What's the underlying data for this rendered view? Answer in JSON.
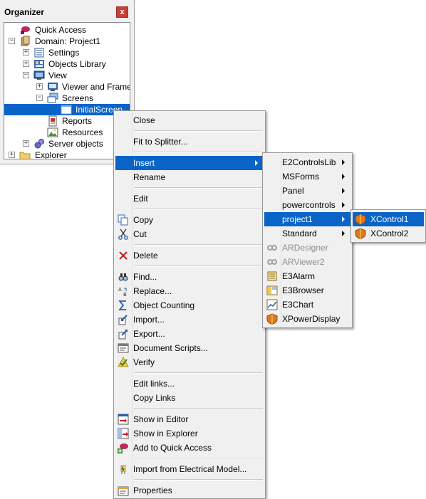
{
  "organizer": {
    "title": "Organizer",
    "close_label": "x",
    "tree": [
      {
        "label": "Quick Access",
        "icon": "quick-access-icon"
      },
      {
        "label": "Domain: Project1",
        "icon": "domain-icon",
        "expander": "−"
      },
      {
        "label": "Settings",
        "icon": "settings-icon",
        "expander": "+"
      },
      {
        "label": "Objects Library",
        "icon": "objects-library-icon",
        "expander": "+"
      },
      {
        "label": "View",
        "icon": "view-icon",
        "expander": "−"
      },
      {
        "label": "Viewer and Frames",
        "icon": "viewer-frames-icon",
        "expander": "+"
      },
      {
        "label": "Screens",
        "icon": "screens-icon",
        "expander": "−"
      },
      {
        "label": "InitialScreen",
        "icon": "screen-icon",
        "selected": true
      },
      {
        "label": "Reports",
        "icon": "reports-icon"
      },
      {
        "label": "Resources",
        "icon": "resources-icon"
      },
      {
        "label": "Server objects",
        "icon": "server-objects-icon",
        "expander": "+"
      },
      {
        "label": "Explorer",
        "icon": "explorer-folder-icon",
        "expander": "+"
      }
    ]
  },
  "context_menu": {
    "items": [
      {
        "label": "Close"
      },
      {
        "label": "Fit to Splitter..."
      },
      {
        "label": "Insert",
        "highlighted": true,
        "submenu": true
      },
      {
        "label": "Rename"
      },
      {
        "label": "Edit"
      },
      {
        "label": "Copy",
        "icon": "copy-icon"
      },
      {
        "label": "Cut",
        "icon": "cut-icon"
      },
      {
        "label": "Delete",
        "icon": "delete-icon"
      },
      {
        "label": "Find...",
        "icon": "find-icon"
      },
      {
        "label": "Replace...",
        "icon": "replace-icon"
      },
      {
        "label": "Object Counting",
        "icon": "sigma-icon"
      },
      {
        "label": "Import...",
        "icon": "import-icon"
      },
      {
        "label": "Export...",
        "icon": "export-icon"
      },
      {
        "label": "Document Scripts...",
        "icon": "scripts-icon"
      },
      {
        "label": "Verify",
        "icon": "verify-icon"
      },
      {
        "label": "Edit links..."
      },
      {
        "label": "Copy Links"
      },
      {
        "label": "Show in Editor",
        "icon": "show-editor-icon"
      },
      {
        "label": "Show in Explorer",
        "icon": "show-explorer-icon"
      },
      {
        "label": "Add to Quick Access",
        "icon": "add-quick-access-icon"
      },
      {
        "label": "Import from Electrical Model...",
        "icon": "electrical-model-icon"
      },
      {
        "label": "Properties",
        "icon": "properties-icon"
      }
    ]
  },
  "insert_submenu": {
    "items": [
      {
        "label": "E2ControlsLib",
        "submenu": true
      },
      {
        "label": "MSForms",
        "submenu": true
      },
      {
        "label": "Panel",
        "submenu": true
      },
      {
        "label": "powercontrols",
        "submenu": true
      },
      {
        "label": "project1",
        "submenu": true,
        "highlighted": true
      },
      {
        "label": "Standard",
        "submenu": true
      },
      {
        "label": "ARDesigner",
        "icon": "ardesigner-icon",
        "disabled": true
      },
      {
        "label": "ARViewer2",
        "icon": "arviewer-icon",
        "disabled": true
      },
      {
        "label": "E3Alarm",
        "icon": "alarm-icon"
      },
      {
        "label": "E3Browser",
        "icon": "browser-icon"
      },
      {
        "label": "E3Chart",
        "icon": "chart-icon"
      },
      {
        "label": "XPowerDisplay",
        "icon": "power-display-icon"
      }
    ]
  },
  "project1_submenu": {
    "items": [
      {
        "label": "XControl1",
        "icon": "xcontrol-icon",
        "highlighted": true
      },
      {
        "label": "XControl2",
        "icon": "xcontrol-icon"
      }
    ]
  },
  "colors": {
    "highlight": "#0a64c8",
    "menu_bg": "#f0f0f0",
    "close_button": "#c7403a"
  }
}
